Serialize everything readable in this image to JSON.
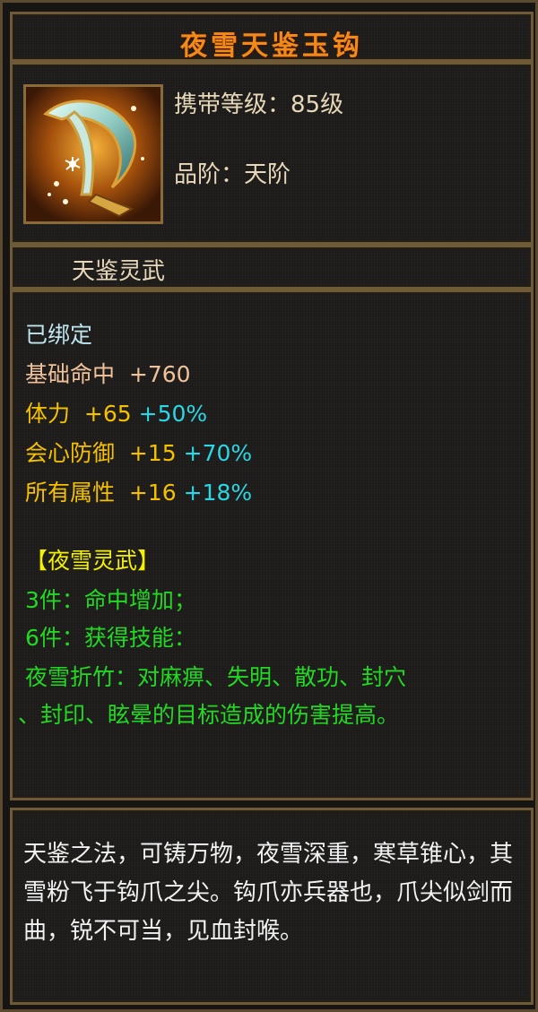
{
  "title": "夜雪天鉴玉钩",
  "item_icon": "jade-hook-weapon-icon",
  "carry_level": "携带等级：85级",
  "grade": "品阶：天阶",
  "category": "天鉴灵武",
  "bound": "已绑定",
  "stats": [
    {
      "name": "基础命中",
      "value": "+760",
      "bonus": ""
    },
    {
      "name": "体力",
      "value": "+65",
      "bonus": "+50%"
    },
    {
      "name": "会心防御",
      "value": "+15",
      "bonus": "+70%"
    },
    {
      "name": "所有属性",
      "value": "+16",
      "bonus": "+18%"
    }
  ],
  "set_name": "【夜雪灵武】",
  "set_bonus_3": "3件：命中增加；",
  "set_bonus_6": "6件：获得技能：",
  "skill_line1": "夜雪折竹：对麻痹、失明、散功、封穴",
  "skill_line2": "、封印、眩晕的目标造成的伤害提高。",
  "description": "天鉴之法，可铸万物，夜雪深重，寒草锥心，其雪粉飞于钩爪之尖。钩爪亦兵器也，爪尖似剑而曲，锐不可当，见血封喉。",
  "colors": {
    "title": "#f08a1a",
    "stat_base": "#f0c29a",
    "stat_gold": "#f5c000",
    "bonus_cyan": "#2ad7e6",
    "set_yellow": "#f3f000",
    "set_green": "#22d822"
  }
}
